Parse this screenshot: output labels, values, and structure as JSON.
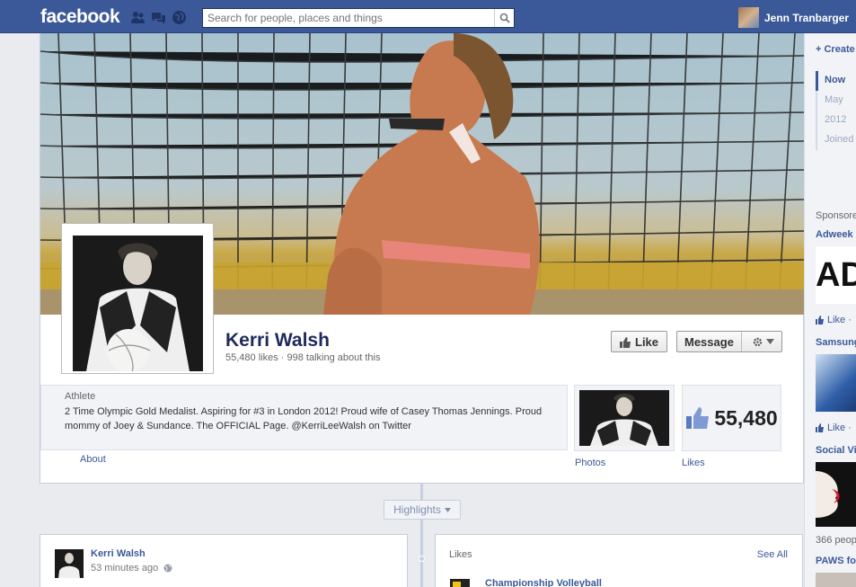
{
  "topbar": {
    "logo": "facebook",
    "search_placeholder": "Search for people, places and things",
    "user_name": "Jenn Tranbarger"
  },
  "page": {
    "name": "Kerri Walsh",
    "stats": "55,480 likes · 998 talking about this",
    "like_button": "Like",
    "message_button": "Message",
    "category": "Athlete",
    "description": "2 Time Olympic Gold Medalist. Aspiring for #3 in London 2012! Proud wife of Casey Thomas Jennings. Proud mommy of Joey & Sundance. The OFFICIAL Page. @KerriLeeWalsh on Twitter",
    "about_link": "About",
    "photos_label": "Photos",
    "likes_count": "55,480",
    "likes_label": "Likes"
  },
  "timeline": {
    "highlights": "Highlights"
  },
  "post": {
    "author": "Kerri Walsh",
    "time": "53 minutes ago"
  },
  "likes_box": {
    "heading": "Likes",
    "see_all": "See All",
    "first_item": "Championship Volleyball"
  },
  "rail": {
    "create": "+ Create",
    "nav": [
      "Now",
      "May",
      "2012",
      "Joined"
    ],
    "sponsored": "Sponsored",
    "ads": [
      {
        "title": "Adweek",
        "like": "Like ·"
      },
      {
        "title": "Samsung",
        "like": "Like ·"
      },
      {
        "title": "Social Vi"
      }
    ],
    "ad3_text": "366 peop",
    "ad4_title": "PAWS fo"
  },
  "colors": {
    "brand": "#3b5998",
    "background": "#e9ebee",
    "panel": "#f2f3f7"
  }
}
